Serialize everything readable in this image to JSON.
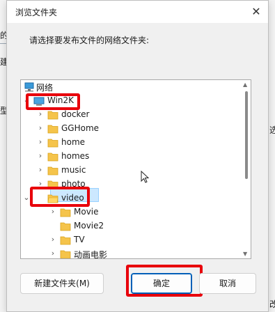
{
  "background": {
    "fragments": [
      "的",
      "建",
      "型",
      "选",
      "改"
    ]
  },
  "dialog": {
    "title": "浏览文件夹",
    "close_label": "✕",
    "prompt": "请选择要发布文件的网络文件夹:"
  },
  "tree": {
    "items": [
      {
        "label": "网络",
        "icon": "network-icon"
      },
      {
        "label": "Win2K",
        "icon": "computer-icon"
      },
      {
        "label": "docker",
        "icon": "folder-icon"
      },
      {
        "label": "GGHome",
        "icon": "folder-icon"
      },
      {
        "label": "home",
        "icon": "folder-icon"
      },
      {
        "label": "homes",
        "icon": "folder-icon"
      },
      {
        "label": "music",
        "icon": "folder-icon"
      },
      {
        "label": "photo",
        "icon": "folder-icon"
      },
      {
        "label": "video",
        "icon": "folder-open-icon"
      },
      {
        "label": "Movie",
        "icon": "folder-icon"
      },
      {
        "label": "Movie2",
        "icon": "folder-icon"
      },
      {
        "label": "TV",
        "icon": "folder-icon"
      },
      {
        "label": "动画电影",
        "icon": "folder-icon"
      }
    ],
    "selected": "video"
  },
  "buttons": {
    "new_folder": "新建文件夹(M)",
    "ok": "确定",
    "cancel": "取消"
  },
  "colors": {
    "highlight": "#e8000b",
    "selection": "#cce8ff",
    "folder": "#f5c44b",
    "accent": "#005fb8"
  }
}
